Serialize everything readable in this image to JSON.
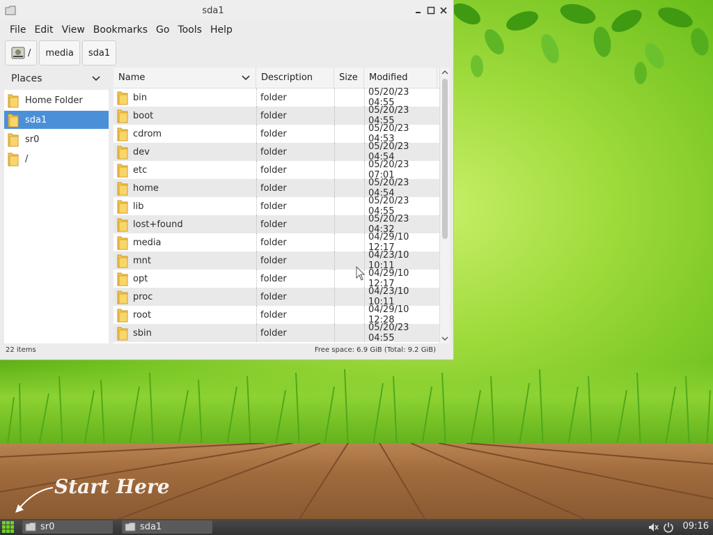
{
  "window": {
    "title": "sda1",
    "icon": "folder-icon"
  },
  "menu": [
    "File",
    "Edit",
    "View",
    "Bookmarks",
    "Go",
    "Tools",
    "Help"
  ],
  "path": {
    "root_label": "/",
    "segments": [
      "media",
      "sda1"
    ]
  },
  "sidepane": {
    "header": "Places",
    "items": [
      {
        "label": "Home Folder",
        "selected": false
      },
      {
        "label": "sda1",
        "selected": true
      },
      {
        "label": "sr0",
        "selected": false
      },
      {
        "label": "/",
        "selected": false
      }
    ]
  },
  "columns": [
    "Name",
    "Description",
    "Size",
    "Modified"
  ],
  "files": [
    {
      "name": "bin",
      "desc": "folder",
      "size": "",
      "modified": "05/20/23 04:55"
    },
    {
      "name": "boot",
      "desc": "folder",
      "size": "",
      "modified": "05/20/23 04:55"
    },
    {
      "name": "cdrom",
      "desc": "folder",
      "size": "",
      "modified": "05/20/23 04:53"
    },
    {
      "name": "dev",
      "desc": "folder",
      "size": "",
      "modified": "05/20/23 04:54"
    },
    {
      "name": "etc",
      "desc": "folder",
      "size": "",
      "modified": "05/20/23 07:01"
    },
    {
      "name": "home",
      "desc": "folder",
      "size": "",
      "modified": "05/20/23 04:54"
    },
    {
      "name": "lib",
      "desc": "folder",
      "size": "",
      "modified": "05/20/23 04:55"
    },
    {
      "name": "lost+found",
      "desc": "folder",
      "size": "",
      "modified": "05/20/23 04:32"
    },
    {
      "name": "media",
      "desc": "folder",
      "size": "",
      "modified": "04/29/10 12:17"
    },
    {
      "name": "mnt",
      "desc": "folder",
      "size": "",
      "modified": "04/23/10 10:11"
    },
    {
      "name": "opt",
      "desc": "folder",
      "size": "",
      "modified": "04/29/10 12:17"
    },
    {
      "name": "proc",
      "desc": "folder",
      "size": "",
      "modified": "04/23/10 10:11"
    },
    {
      "name": "root",
      "desc": "folder",
      "size": "",
      "modified": "04/29/10 12:28"
    },
    {
      "name": "sbin",
      "desc": "folder",
      "size": "",
      "modified": "05/20/23 04:55"
    }
  ],
  "status": {
    "items": "22 items",
    "free_space": "Free space: 6.9 GiB (Total: 9.2 GiB)"
  },
  "desktop": {
    "wallpaper_text": "Start Here"
  },
  "taskbar": {
    "tasks": [
      "sr0",
      "sda1"
    ],
    "clock": "09:16"
  },
  "colors": {
    "selection": "#4a90d9",
    "folder": "#f5c84c",
    "taskbar": "#3c3c3c"
  }
}
